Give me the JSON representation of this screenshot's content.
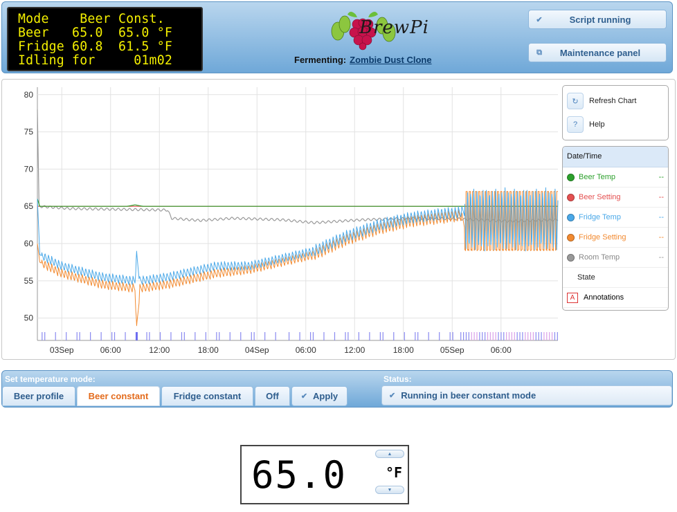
{
  "lcd": {
    "lines": [
      "Mode    Beer Const.",
      "Beer   65.0  65.0 °F",
      "Fridge 60.8  61.5 °F",
      "Idling for     01m02"
    ]
  },
  "header": {
    "logo_text": "BrewPi",
    "fermenting_label": "Fermenting:",
    "beer_name": "Zombie Dust Clone",
    "script_button": "Script running",
    "maintenance_button": "Maintenance panel"
  },
  "chart_panel": {
    "refresh_label": "Refresh Chart",
    "help_label": "Help",
    "help_icon_text": "?",
    "legend_header": "Date/Time",
    "legend": [
      {
        "name": "Beer Temp",
        "color": "#2ca02c",
        "value": "--"
      },
      {
        "name": "Beer Setting",
        "color": "#e45050",
        "value": "--"
      },
      {
        "name": "Fridge Temp",
        "color": "#4aa8e8",
        "value": "--"
      },
      {
        "name": "Fridge Setting",
        "color": "#f28a30",
        "value": "--"
      },
      {
        "name": "Room Temp",
        "color": "#999999",
        "value": "--"
      },
      {
        "name": "State",
        "color": "#ffffff",
        "value": ""
      }
    ],
    "annotations_label": "Annotations",
    "annotations_icon_text": "A"
  },
  "chart_data": {
    "type": "line",
    "x_ticks": [
      "03Sep",
      "06:00",
      "12:00",
      "18:00",
      "04Sep",
      "06:00",
      "12:00",
      "18:00",
      "05Sep",
      "06:00"
    ],
    "y_ticks": [
      50,
      55,
      60,
      65,
      70,
      75,
      80
    ],
    "ylim": [
      47,
      81
    ],
    "x_hours": [
      0,
      64
    ],
    "series": [
      {
        "name": "Beer Temp",
        "color": "#2ca02c",
        "points": [
          [
            0,
            66
          ],
          [
            0.3,
            65
          ],
          [
            2,
            65
          ],
          [
            11,
            65
          ],
          [
            12,
            65.2
          ],
          [
            13,
            65
          ],
          [
            64,
            65
          ]
        ]
      },
      {
        "name": "Beer Setting",
        "color": "#e45050",
        "points": [
          [
            0,
            65
          ],
          [
            64,
            65
          ]
        ]
      },
      {
        "name": "Room Temp",
        "color": "#999999",
        "points": [
          [
            0,
            78
          ],
          [
            0.2,
            65
          ],
          [
            4,
            64.7
          ],
          [
            10,
            64.6
          ],
          [
            16,
            64.5
          ],
          [
            16.5,
            63.4
          ],
          [
            20,
            63.1
          ],
          [
            24,
            63.4
          ],
          [
            30,
            63.2
          ],
          [
            34,
            62.8
          ],
          [
            40,
            63.2
          ],
          [
            46,
            63.4
          ],
          [
            52,
            63.3
          ],
          [
            58,
            63
          ],
          [
            64,
            63.2
          ]
        ]
      },
      {
        "name": "Fridge Temp",
        "color": "#4aa8e8",
        "points": [
          [
            0,
            66
          ],
          [
            0.3,
            58.5
          ],
          [
            3,
            57
          ],
          [
            8,
            55.5
          ],
          [
            12,
            55
          ],
          [
            12.2,
            58.5
          ],
          [
            12.6,
            55
          ],
          [
            16,
            55.5
          ],
          [
            18,
            56
          ],
          [
            22,
            57
          ],
          [
            26,
            57
          ],
          [
            30,
            58
          ],
          [
            34,
            59
          ],
          [
            38,
            61
          ],
          [
            42,
            62.5
          ],
          [
            46,
            63.5
          ],
          [
            50,
            64
          ],
          [
            52,
            64.2
          ],
          [
            54,
            65.5
          ],
          [
            64,
            65
          ]
        ],
        "osc_start": [
          52.5,
          64
        ],
        "osc_range": [
          59,
          67.5
        ]
      },
      {
        "name": "Fridge Setting",
        "color": "#f28a30",
        "points": [
          [
            0,
            60
          ],
          [
            0.3,
            57.5
          ],
          [
            3,
            56
          ],
          [
            8,
            54.5
          ],
          [
            12,
            54
          ],
          [
            12.2,
            48.5
          ],
          [
            12.6,
            54
          ],
          [
            16,
            54.5
          ],
          [
            18,
            55
          ],
          [
            22,
            56
          ],
          [
            26,
            56.5
          ],
          [
            30,
            57.5
          ],
          [
            34,
            58.5
          ],
          [
            38,
            60.5
          ],
          [
            42,
            62
          ],
          [
            46,
            63
          ],
          [
            50,
            63.5
          ],
          [
            52,
            63.8
          ],
          [
            54,
            60.5
          ],
          [
            64,
            60.5
          ]
        ],
        "osc_start": [
          52.5,
          64
        ],
        "osc_range": [
          59,
          67
        ]
      }
    ]
  },
  "controls": {
    "mode_title": "Set temperature mode:",
    "status_title": "Status:",
    "modes": [
      "Beer profile",
      "Beer constant",
      "Fridge constant",
      "Off"
    ],
    "apply_label": "Apply",
    "status_text": "Running in beer constant mode"
  },
  "setter": {
    "value": "65.0",
    "unit": "°F"
  }
}
